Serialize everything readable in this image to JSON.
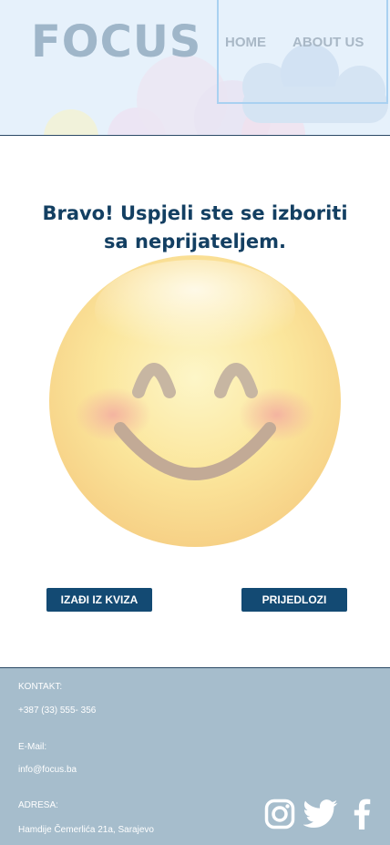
{
  "header": {
    "logo": "FOCUS",
    "nav": {
      "home": "HOME",
      "about": "ABOUT US"
    }
  },
  "main": {
    "title": "Bravo! Uspjeli ste se izboriti sa neprijateljem.",
    "emoji_icon": "smiling-face-icon",
    "buttons": {
      "exit": "IZAĐI IZ KVIZA",
      "suggestions": "PRIJEDLOZI"
    }
  },
  "footer": {
    "contact_label": "KONTAKT:",
    "phone": "+387 (33) 555- 356",
    "email_label": "E-Mail:",
    "email": "info@focus.ba",
    "address_label": "ADRESA:",
    "address": "Hamdije Čemerlića 21a, Sarajevo",
    "social_icons": [
      "instagram-icon",
      "twitter-icon",
      "facebook-icon"
    ]
  },
  "colors": {
    "header_bg": "#e6f1fb",
    "primary": "#134a73",
    "title": "#133f62",
    "footer_bg": "#a6bdcc"
  }
}
